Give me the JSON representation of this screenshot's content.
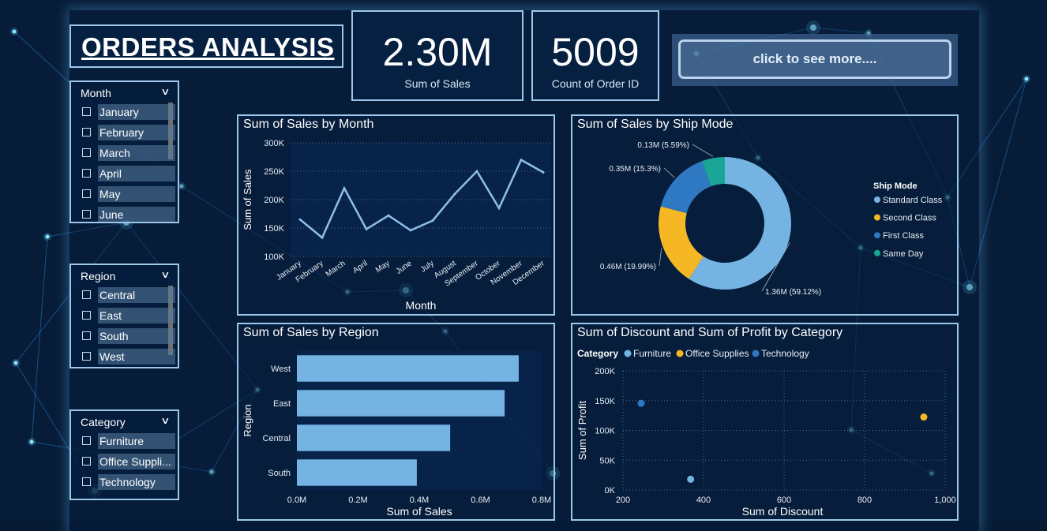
{
  "header": {
    "title": "ORDERS ANALYSIS",
    "kpi_sales": {
      "value": "2.30M",
      "label": "Sum of Sales"
    },
    "kpi_orders": {
      "value": "5009",
      "label": "Count of Order ID"
    },
    "more_button": "click to see more...."
  },
  "slicers": {
    "month": {
      "title": "Month",
      "items": [
        "January",
        "February",
        "March",
        "April",
        "May",
        "June"
      ]
    },
    "region": {
      "title": "Region",
      "items": [
        "Central",
        "East",
        "South",
        "West"
      ]
    },
    "category": {
      "title": "Category",
      "items": [
        "Furniture",
        "Office Suppli...",
        "Technology"
      ]
    }
  },
  "panels": {
    "month": "Sum of Sales by Month",
    "shipmode": "Sum of Sales by Ship Mode",
    "region": "Sum of Sales by Region",
    "discount": "Sum of Discount and Sum of Profit by Category"
  },
  "colors": {
    "light_blue": "#75b3e3",
    "yellow": "#f5b724",
    "mid_blue": "#2f78c2",
    "teal": "#1aa596"
  },
  "chart_data": [
    {
      "type": "line",
      "title": "Sum of Sales by Month",
      "xlabel": "Month",
      "ylabel": "Sum of Sales",
      "categories": [
        "January",
        "February",
        "March",
        "April",
        "May",
        "June",
        "July",
        "August",
        "September",
        "October",
        "November",
        "December"
      ],
      "values": [
        165000,
        133000,
        220000,
        148000,
        172000,
        146000,
        163000,
        210000,
        250000,
        185000,
        270000,
        248000
      ],
      "ylim": [
        100000,
        300000
      ],
      "yticks": [
        "100K",
        "150K",
        "200K",
        "250K",
        "300K"
      ],
      "grid": true
    },
    {
      "type": "pie",
      "title": "Sum of Sales by Ship Mode",
      "legend_title": "Ship Mode",
      "legend_position": "right",
      "slices": [
        {
          "name": "Standard Class",
          "value": 1.36,
          "label": "1.36M (59.12%)",
          "color": "#75b3e3"
        },
        {
          "name": "Second Class",
          "value": 0.46,
          "label": "0.46M (19.99%)",
          "color": "#f5b724"
        },
        {
          "name": "First Class",
          "value": 0.35,
          "label": "0.35M (15.3%)",
          "color": "#2f78c2"
        },
        {
          "name": "Same Day",
          "value": 0.13,
          "label": "0.13M (5.59%)",
          "color": "#1aa596"
        }
      ]
    },
    {
      "type": "bar",
      "title": "Sum of Sales by Region",
      "xlabel": "Sum of Sales",
      "ylabel": "Region",
      "categories": [
        "West",
        "East",
        "Central",
        "South"
      ],
      "values": [
        0.725,
        0.679,
        0.501,
        0.392
      ],
      "xlim": [
        0,
        0.8
      ],
      "xticks": [
        "0.0M",
        "0.2M",
        "0.4M",
        "0.6M",
        "0.8M"
      ]
    },
    {
      "type": "scatter",
      "title": "Sum of Discount and Sum of Profit by Category",
      "legend_title": "Category",
      "legend_position": "top-left",
      "xlabel": "Sum of Discount",
      "ylabel": "Sum of Profit",
      "xlim": [
        200,
        1000
      ],
      "ylim": [
        0,
        200000
      ],
      "xticks": [
        "200",
        "400",
        "600",
        "800",
        "1,000"
      ],
      "yticks": [
        "0K",
        "50K",
        "100K",
        "150K",
        "200K"
      ],
      "series": [
        {
          "name": "Furniture",
          "x": 368,
          "y": 18000,
          "color": "#75b3e3"
        },
        {
          "name": "Office Supplies",
          "x": 947,
          "y": 122500,
          "color": "#f5b724"
        },
        {
          "name": "Technology",
          "x": 245,
          "y": 145500,
          "color": "#2f78c2"
        }
      ]
    }
  ]
}
